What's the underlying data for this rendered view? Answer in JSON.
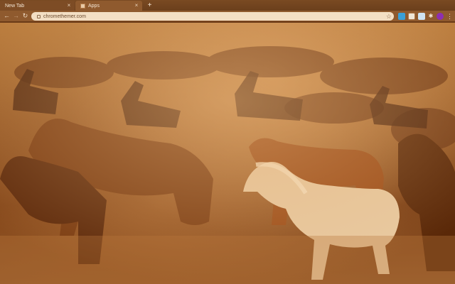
{
  "tabs": [
    {
      "label": "New Tab",
      "active": false
    },
    {
      "label": "Apps",
      "active": true
    }
  ],
  "toolbar": {
    "back_icon": "arrow-left-icon",
    "forward_icon": "arrow-right-icon",
    "reload_icon": "reload-icon",
    "star_icon": "star-icon"
  },
  "omnibox": {
    "url": "chromethemer.com"
  },
  "theme": {
    "accent": "#8f5a2e",
    "tabstrip": "#6b3f1c",
    "omnibox_bg": "#f3dfc4"
  },
  "background": {
    "subject": "herd of horses in dust"
  }
}
